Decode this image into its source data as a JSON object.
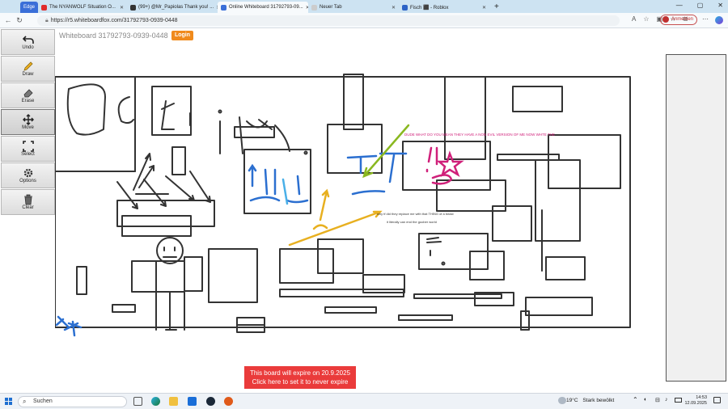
{
  "browser": {
    "tabs": [
      {
        "label": "Edge",
        "color": "#3a6fd8"
      },
      {
        "label": "The NYANWOLF Situation O...",
        "color": "#e02b2b"
      },
      {
        "label": "(99+) @Mr_Papiolas Thank you! ...",
        "color": "#333333"
      },
      {
        "label": "Online Whiteboard 31792793-09...",
        "color": "#3a6fd8"
      },
      {
        "label": "Neuer Tab",
        "color": "#cccccc"
      },
      {
        "label": "Fisch ⬛ - Roblox",
        "color": "#2b62c6"
      }
    ],
    "new_tab_icon": "plus-icon",
    "url": "https://r5.whiteboardfox.com/31792793-0939-0448",
    "signin_label": "Anmelden"
  },
  "toolbar": {
    "undo": "Undo",
    "draw": "Draw",
    "erase": "Erase",
    "move": "Move",
    "select": "Select",
    "options": "Options",
    "clear": "Clear"
  },
  "board": {
    "title": "Whiteboard 31792793-0939-0448",
    "login_label": "Login",
    "note_pink": "DUDE WHAT DO YOU MEAN THEY HAVE A NON EVIL VERSION OF ME NOW WHTE THE",
    "note_small_1": "why tf did they replace me with that THING of a beast",
    "note_small_2": "it literally can end the goober world",
    "expire_line1": "This board will expire on 20.9.2025",
    "expire_line2": "Click here to set it to never expire"
  },
  "taskbar": {
    "search_placeholder": "Suchen",
    "weather_temp": "19°C",
    "weather_text": "Stark bewölkt",
    "time": "14:53",
    "date": "12.09.2025"
  },
  "colors": {
    "accent_orange": "#f08a1c",
    "expire_red": "#ea3b3b",
    "ink": "#333333",
    "blue": "#2b6fd0",
    "yellow": "#e8b020",
    "pink": "#d0207a",
    "green": "#8ab820"
  }
}
